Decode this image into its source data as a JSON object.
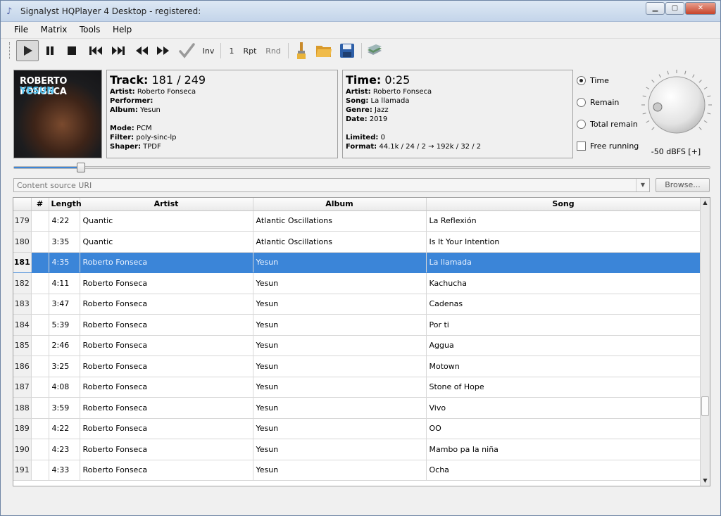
{
  "window": {
    "title": "Signalyst HQPlayer 4 Desktop - registered:"
  },
  "menu": [
    "File",
    "Matrix",
    "Tools",
    "Help"
  ],
  "toolbar": {
    "inv_label": "Inv",
    "count_label": "1",
    "rpt_label": "Rpt",
    "rnd_label": "Rnd"
  },
  "album_art": {
    "artist": "ROBERTO FONSECA",
    "title": "YESUN"
  },
  "track_panel": {
    "heading_label": "Track:",
    "heading_value": "181 / 249",
    "fields": [
      {
        "label": "Artist:",
        "value": "Roberto Fonseca"
      },
      {
        "label": "Performer:",
        "value": ""
      },
      {
        "label": "Album:",
        "value": "Yesun"
      }
    ],
    "fields2": [
      {
        "label": "Mode:",
        "value": "PCM"
      },
      {
        "label": "Filter:",
        "value": "poly-sinc-lp"
      },
      {
        "label": "Shaper:",
        "value": "TPDF"
      }
    ]
  },
  "time_panel": {
    "heading_label": "Time:",
    "heading_value": "0:25",
    "fields": [
      {
        "label": "Artist:",
        "value": "Roberto Fonseca"
      },
      {
        "label": "Song:",
        "value": "La llamada"
      },
      {
        "label": "Genre:",
        "value": "Jazz"
      },
      {
        "label": "Date:",
        "value": "2019"
      }
    ],
    "fields2": [
      {
        "label": "Limited:",
        "value": "0"
      },
      {
        "label": "Format:",
        "value": "44.1k / 24 / 2 → 192k / 32 / 2"
      }
    ]
  },
  "display_options": {
    "time": "Time",
    "remain": "Remain",
    "total_remain": "Total remain",
    "free_running": "Free running",
    "selected": "Time"
  },
  "volume": {
    "label": "-50 dBFS [+]"
  },
  "seek": {
    "position_fraction": 0.097
  },
  "source": {
    "placeholder": "Content source URI",
    "browse_label": "Browse..."
  },
  "playlist": {
    "columns": [
      "#",
      "Length",
      "Artist",
      "Album",
      "Song"
    ],
    "selected_index": 181,
    "rows": [
      {
        "num": "179",
        "length": "4:22",
        "artist": "Quantic",
        "album": "Atlantic Oscillations",
        "song": "La Reflexión"
      },
      {
        "num": "180",
        "length": "3:35",
        "artist": "Quantic",
        "album": "Atlantic Oscillations",
        "song": "Is It Your Intention"
      },
      {
        "num": "181",
        "length": "4:35",
        "artist": "Roberto Fonseca",
        "album": "Yesun",
        "song": "La llamada"
      },
      {
        "num": "182",
        "length": "4:11",
        "artist": "Roberto Fonseca",
        "album": "Yesun",
        "song": "Kachucha"
      },
      {
        "num": "183",
        "length": "3:47",
        "artist": "Roberto Fonseca",
        "album": "Yesun",
        "song": "Cadenas"
      },
      {
        "num": "184",
        "length": "5:39",
        "artist": "Roberto Fonseca",
        "album": "Yesun",
        "song": "Por ti"
      },
      {
        "num": "185",
        "length": "2:46",
        "artist": "Roberto Fonseca",
        "album": "Yesun",
        "song": "Aggua"
      },
      {
        "num": "186",
        "length": "3:25",
        "artist": "Roberto Fonseca",
        "album": "Yesun",
        "song": "Motown"
      },
      {
        "num": "187",
        "length": "4:08",
        "artist": "Roberto Fonseca",
        "album": "Yesun",
        "song": "Stone of Hope"
      },
      {
        "num": "188",
        "length": "3:59",
        "artist": "Roberto Fonseca",
        "album": "Yesun",
        "song": "Vivo"
      },
      {
        "num": "189",
        "length": "4:22",
        "artist": "Roberto Fonseca",
        "album": "Yesun",
        "song": "OO"
      },
      {
        "num": "190",
        "length": "4:23",
        "artist": "Roberto Fonseca",
        "album": "Yesun",
        "song": "Mambo pa la niña"
      },
      {
        "num": "191",
        "length": "4:33",
        "artist": "Roberto Fonseca",
        "album": "Yesun",
        "song": "Ocha"
      }
    ]
  },
  "colors": {
    "selection": "#3b85d8",
    "seek_fill": "#3d86d8"
  }
}
